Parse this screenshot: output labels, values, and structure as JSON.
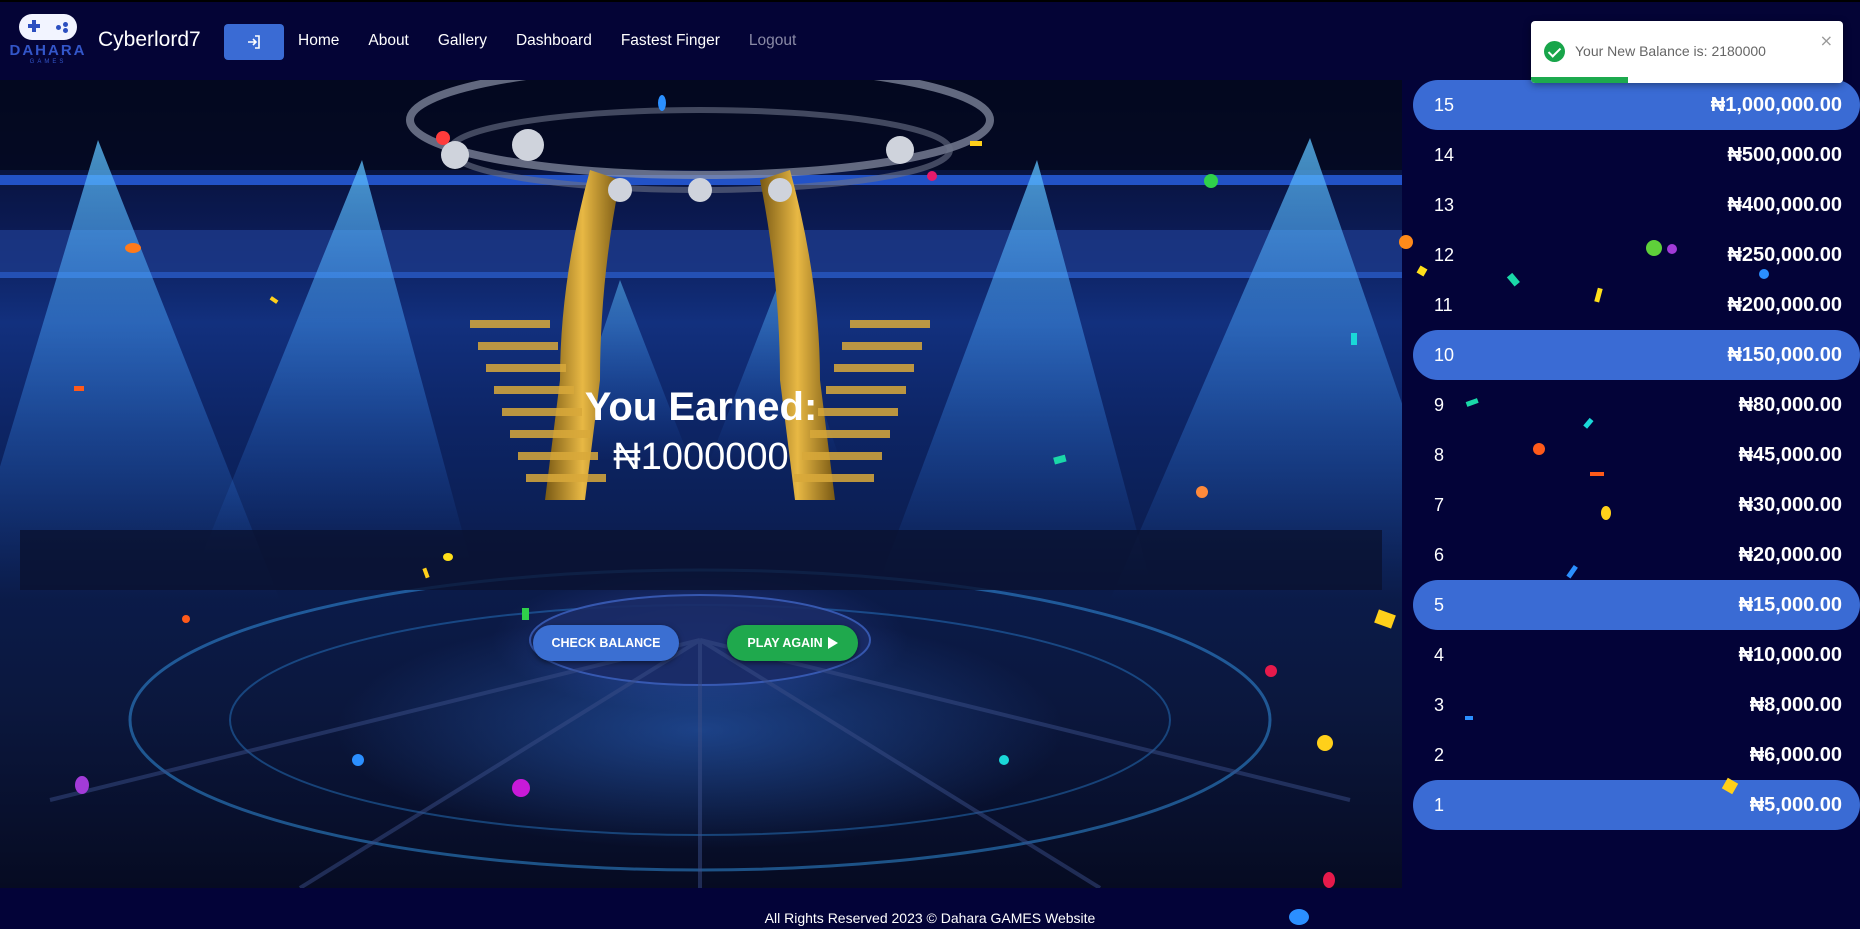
{
  "brand": {
    "logo_word": "DAHARA",
    "logo_sub": "GAMES",
    "username": "Cyberlord7"
  },
  "nav": {
    "login_icon": "sign-in-icon",
    "links": [
      "Home",
      "About",
      "Gallery",
      "Dashboard",
      "Fastest Finger",
      "Logout"
    ]
  },
  "main": {
    "earned_title": "You Earned:",
    "earned_amount": "₦1000000",
    "check_balance": "CHECK BALANCE",
    "play_again": "PLAY AGAIN",
    "play_icon": "play-icon"
  },
  "ladder": [
    {
      "level": "15",
      "amount": "₦1,000,000.00",
      "highlight": true
    },
    {
      "level": "14",
      "amount": "₦500,000.00",
      "highlight": false
    },
    {
      "level": "13",
      "amount": "₦400,000.00",
      "highlight": false
    },
    {
      "level": "12",
      "amount": "₦250,000.00",
      "highlight": false
    },
    {
      "level": "11",
      "amount": "₦200,000.00",
      "highlight": false
    },
    {
      "level": "10",
      "amount": "₦150,000.00",
      "highlight": true
    },
    {
      "level": "9",
      "amount": "₦80,000.00",
      "highlight": false
    },
    {
      "level": "8",
      "amount": "₦45,000.00",
      "highlight": false
    },
    {
      "level": "7",
      "amount": "₦30,000.00",
      "highlight": false
    },
    {
      "level": "6",
      "amount": "₦20,000.00",
      "highlight": false
    },
    {
      "level": "5",
      "amount": "₦15,000.00",
      "highlight": true
    },
    {
      "level": "4",
      "amount": "₦10,000.00",
      "highlight": false
    },
    {
      "level": "3",
      "amount": "₦8,000.00",
      "highlight": false
    },
    {
      "level": "2",
      "amount": "₦6,000.00",
      "highlight": false
    },
    {
      "level": "1",
      "amount": "₦5,000.00",
      "highlight": true
    }
  ],
  "toast": {
    "message": "Your New Balance is: 2180000",
    "close": "×",
    "progress": 0.31,
    "icon": "check-circle-icon"
  },
  "footer": {
    "text": "All Rights Reserved 2023 © Dahara GAMES Website"
  },
  "colors": {
    "page_bg": "#030338",
    "highlight": "#3a6bd4",
    "success": "#1fa94d"
  }
}
